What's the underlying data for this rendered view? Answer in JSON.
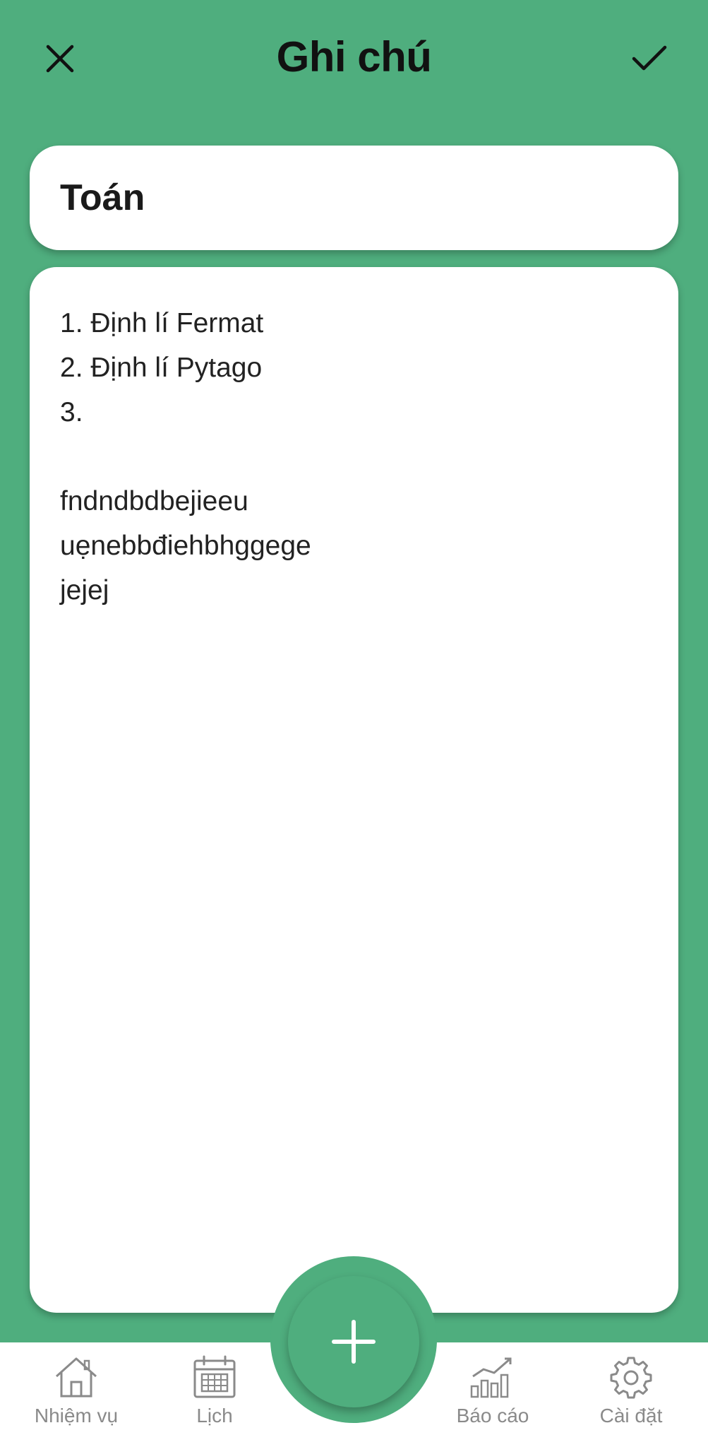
{
  "header": {
    "title": "Ghi chú",
    "close_icon": "close-icon",
    "confirm_icon": "check-icon"
  },
  "subject": {
    "value": "Toán"
  },
  "note": {
    "lines": [
      "1. Định lí Fermat",
      "2. Định lí Pytago",
      "3.",
      "",
      "fndndbdbejieeu",
      "uẹnebbđiehbhggege",
      "jejej"
    ]
  },
  "fab": {
    "icon": "plus-icon"
  },
  "bottom_nav": {
    "items": [
      {
        "label": "Nhiệm vụ",
        "icon": "home-icon"
      },
      {
        "label": "Lịch",
        "icon": "calendar-icon"
      },
      {
        "label": "Báo cáo",
        "icon": "bar-chart-icon"
      },
      {
        "label": "Cài đặt",
        "icon": "gear-icon"
      }
    ]
  },
  "colors": {
    "primary": "#4fae7e",
    "card": "#ffffff",
    "nav_inactive": "#8a8a8a"
  }
}
